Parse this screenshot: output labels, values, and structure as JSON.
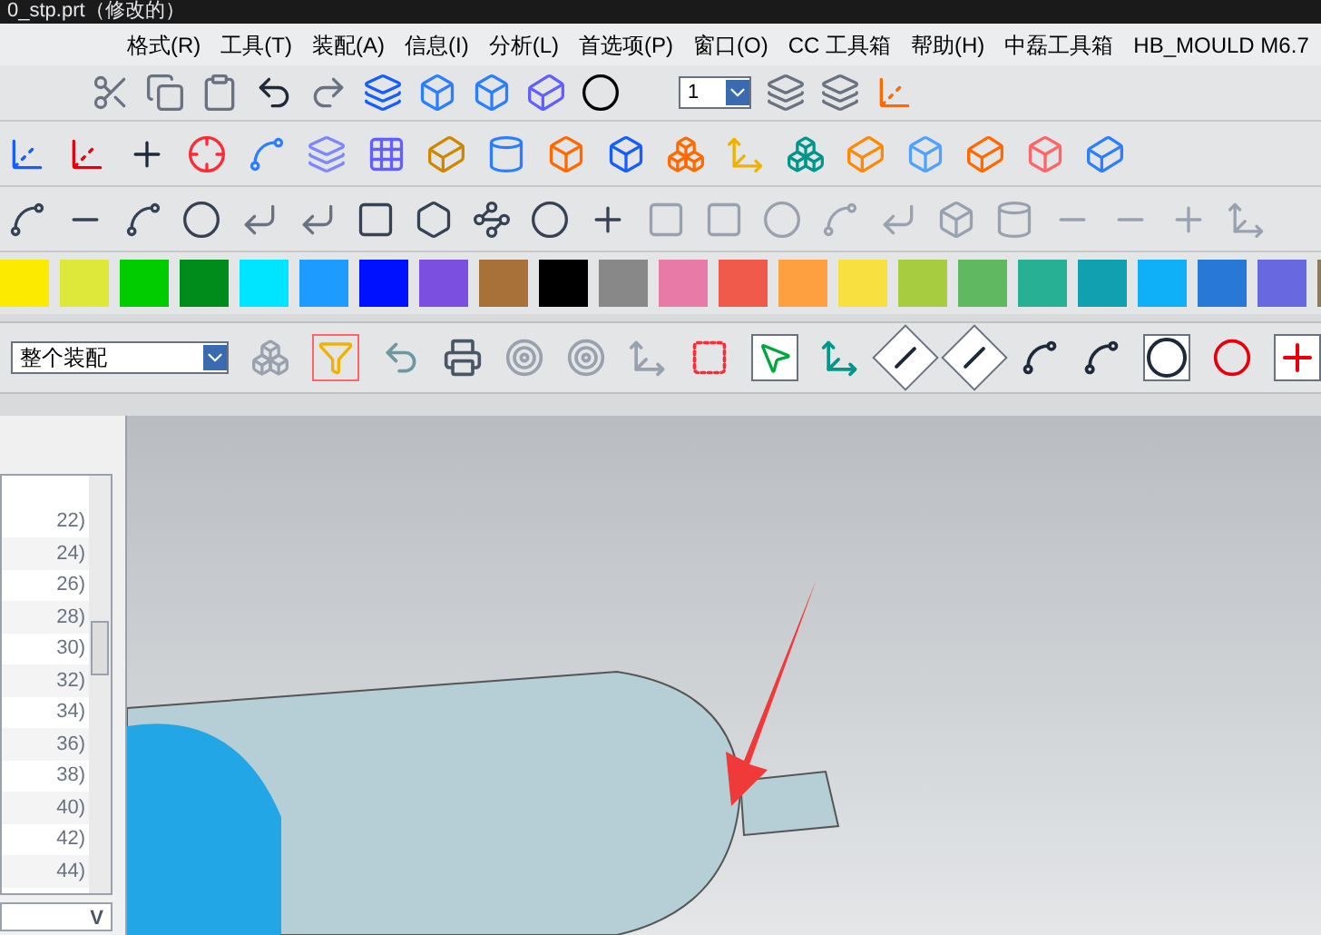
{
  "window": {
    "title": "0_stp.prt（修改的）"
  },
  "menu": [
    "格式(R)",
    "工具(T)",
    "装配(A)",
    "信息(I)",
    "分析(L)",
    "首选项(P)",
    "窗口(O)",
    "CC 工具箱",
    "帮助(H)",
    "中磊工具箱",
    "HB_MOULD M6.7"
  ],
  "layer_combo": {
    "value": "1"
  },
  "colors": [
    {
      "color": "#fcea00"
    },
    {
      "color": "#dde83a"
    },
    {
      "color": "#00cc00"
    },
    {
      "color": "#008c1a"
    },
    {
      "color": "#00e5ff"
    },
    {
      "color": "#1e9bff"
    },
    {
      "color": "#0011ff"
    },
    {
      "color": "#7b4fe0"
    },
    {
      "color": "#a8713a"
    },
    {
      "color": "#000000"
    },
    {
      "color": "#888888"
    },
    {
      "color": "#e87aa8"
    },
    {
      "color": "#f05a4a"
    },
    {
      "color": "#ffa040"
    },
    {
      "color": "#f8e040"
    },
    {
      "color": "#a8cc40"
    },
    {
      "color": "#60b860"
    },
    {
      "color": "#28b094"
    },
    {
      "color": "#10a0b0"
    },
    {
      "color": "#10b0f8"
    },
    {
      "color": "#2878d8"
    },
    {
      "color": "#6868e0"
    },
    {
      "color": "#8a7a60"
    }
  ],
  "selection_bar": {
    "scope": "整个装配"
  },
  "part_list": {
    "rows": [
      "22)",
      "24)",
      "26)",
      "28)",
      "30)",
      "32)",
      "34)",
      "36)",
      "38)",
      "40)",
      "42)",
      "44)"
    ]
  },
  "bottom_combo": {
    "value": "V"
  }
}
